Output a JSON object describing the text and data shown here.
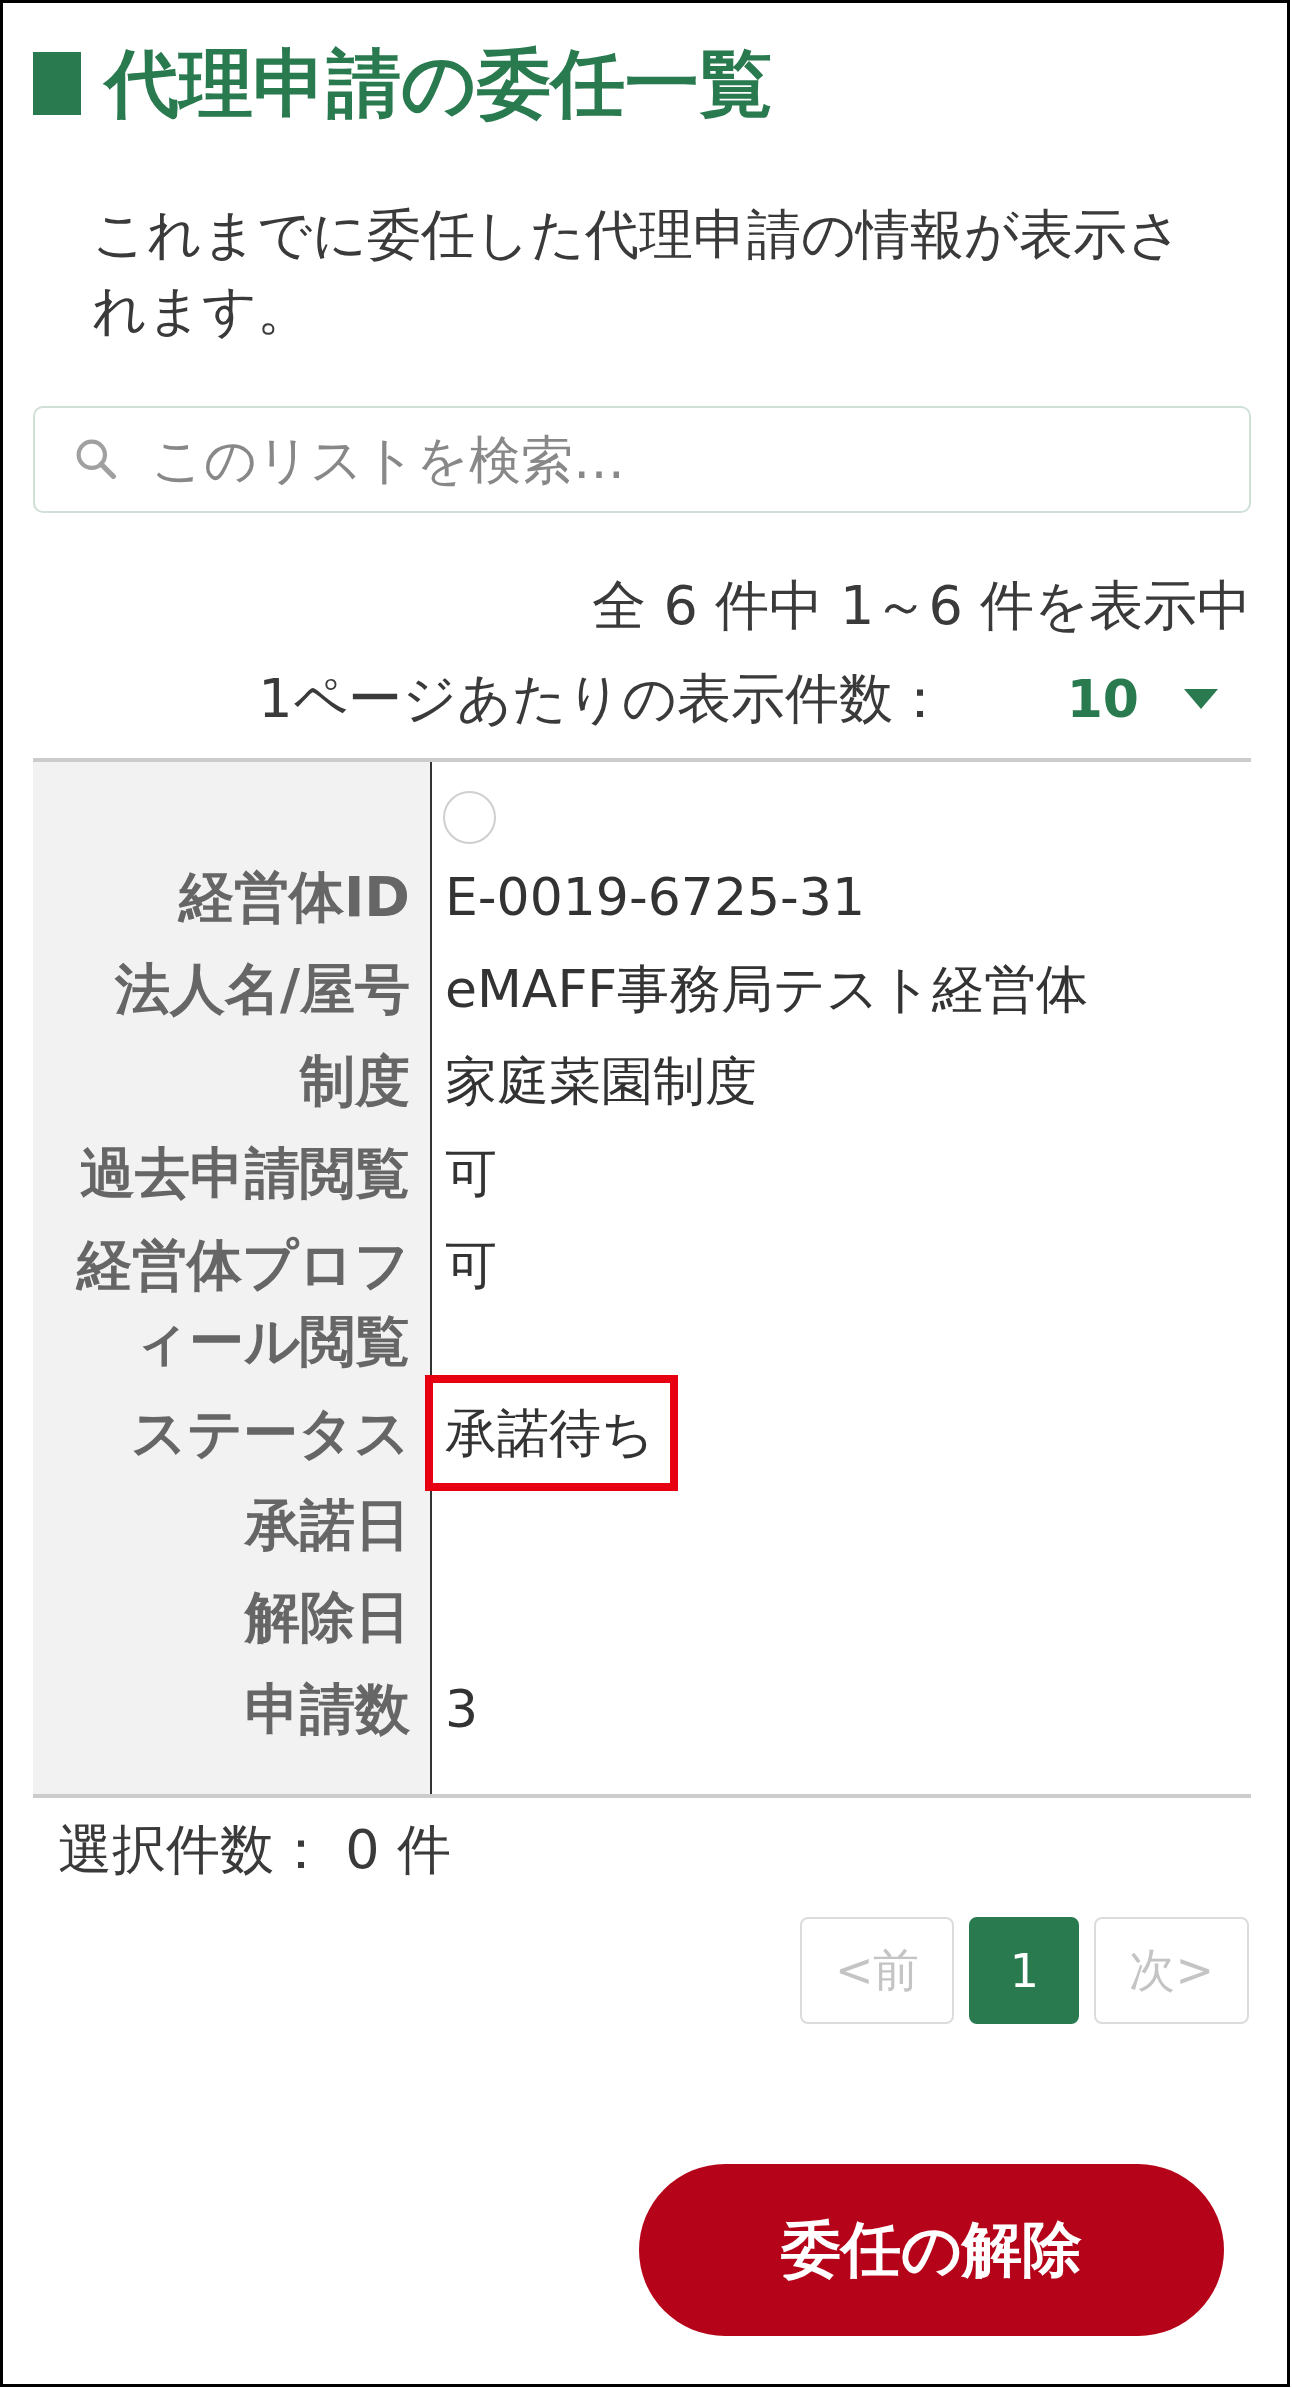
{
  "title": "代理申請の委任一覧",
  "description": "これまでに委任した代理申請の情報が表示されます。",
  "search": {
    "placeholder": "このリストを検索…"
  },
  "summary": "全 6 件中 1～6 件を表示中",
  "page_size": {
    "label": "1ページあたりの表示件数：",
    "value": "10"
  },
  "records": [
    {
      "selected": false,
      "fields": [
        {
          "label": "経営体ID",
          "value": "E-0019-6725-31",
          "highlighted": false
        },
        {
          "label": "法人名/屋号",
          "value": "eMAFF事務局テスト経営体",
          "highlighted": false
        },
        {
          "label": "制度",
          "value": "家庭菜園制度",
          "highlighted": false
        },
        {
          "label": "過去申請閲覧",
          "value": "可",
          "highlighted": false
        },
        {
          "label": "経営体プロフィール閲覧",
          "value": "可",
          "highlighted": false
        },
        {
          "label": "ステータス",
          "value": "承諾待ち",
          "highlighted": true
        },
        {
          "label": "承諾日",
          "highlighted": false
        },
        {
          "label": "解除日",
          "highlighted": false
        },
        {
          "label": "申請数",
          "value": "3",
          "highlighted": false
        }
      ]
    }
  ],
  "selection_count": "選択件数： 0 件",
  "pagination": [
    {
      "label": "<前",
      "selected": false,
      "disabled": true
    },
    {
      "label": "1",
      "selected": true,
      "disabled": false
    },
    {
      "label": "次>",
      "selected": false,
      "disabled": true
    }
  ],
  "buttons": [
    {
      "label": "委任の解除"
    }
  ]
}
